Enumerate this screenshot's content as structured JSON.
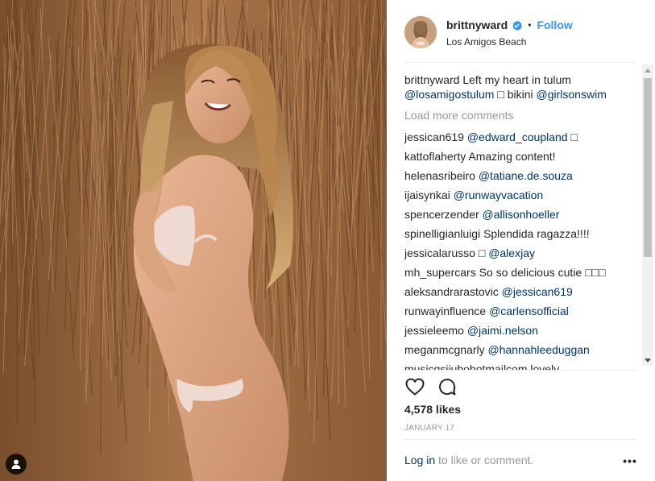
{
  "post": {
    "username": "brittnyward",
    "location": "Los Amigos Beach",
    "follow_label": "Follow",
    "separator": "•",
    "caption": {
      "username": "brittnyward",
      "text_before": "Left my heart in tulum",
      "mention1": "@losamigostulum",
      "text_middle": "□ bikini",
      "mention2": "@girlsonswim"
    },
    "load_more": "Load more comments",
    "likes": "4,578 likes",
    "date": "JANUARY 17",
    "login_link": "Log in",
    "login_text": " to like or comment.",
    "more_label": "•••"
  },
  "comments": [
    {
      "user": "jessican619",
      "mention": "@edward_coupland",
      "text": " □"
    },
    {
      "user": "kattoflaherty",
      "mention": "",
      "text": "Amazing content!"
    },
    {
      "user": "helenasribeiro",
      "mention": "@tatiane.de.souza",
      "text": ""
    },
    {
      "user": "ijaisynkai",
      "mention": "@runwayvacation",
      "text": ""
    },
    {
      "user": "spencerzender",
      "mention": "@allisonhoeller",
      "text": ""
    },
    {
      "user": "spinelligianluigi",
      "mention": "",
      "text": "Splendida ragazza!!!!"
    },
    {
      "user": "jessicalarusso",
      "pre": "□",
      "mention": "@alexjay",
      "text": ""
    },
    {
      "user": "mh_supercars",
      "mention": "",
      "text": "So so delicious cutie □□□"
    },
    {
      "user": "aleksandrarastovic",
      "mention": "@jessican619",
      "text": ""
    },
    {
      "user": "runwayinfluence",
      "mention": "@carlensofficial",
      "text": ""
    },
    {
      "user": "jessieleemo",
      "mention": "@jaimi.nelson",
      "text": ""
    },
    {
      "user": "meganmcgnarly",
      "mention": "@hannahleeduggan",
      "text": ""
    },
    {
      "user": "musicqsijubobotmailcom",
      "mention": "",
      "text": "lovely"
    }
  ],
  "icons": {
    "verified": "verified-badge-icon",
    "heart": "heart-icon",
    "comment": "comment-bubble-icon",
    "user_tag": "user-tag-icon",
    "more": "more-options-icon"
  },
  "colors": {
    "link": "#003569",
    "follow": "#3897f0",
    "muted": "#999999",
    "verified": "#3897f0"
  }
}
